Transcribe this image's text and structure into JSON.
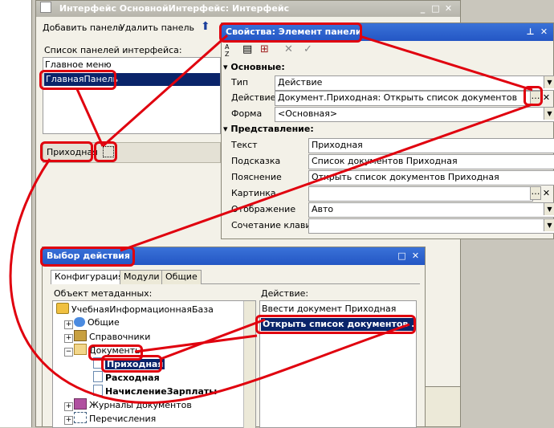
{
  "interface_window": {
    "title": "Интерфейс ОсновнойИнтерфейс: Интерфейс",
    "add_panel": "Добавить панель",
    "delete_panel": "Удалить панель",
    "list_label": "Список панелей интерфейса:",
    "panels": [
      "Главное меню",
      "ГлавнаяПанель"
    ],
    "panel_item": "Приходная"
  },
  "properties": {
    "title": "Свойства: Элемент панели",
    "section_main": "Основные:",
    "section_view": "Представление:",
    "rows_main": [
      {
        "label": "Тип",
        "value": "Действие"
      },
      {
        "label": "Действие",
        "value": "Документ.Приходная: Открыть список документов"
      },
      {
        "label": "Форма",
        "value": "<Основная>"
      }
    ],
    "rows_view": [
      {
        "label": "Текст",
        "value": "Приходная"
      },
      {
        "label": "Подсказка",
        "value": "Список документов Приходная"
      },
      {
        "label": "Пояснение",
        "value": "Открыть список документов Приходная"
      },
      {
        "label": "Картинка",
        "value": ""
      },
      {
        "label": "Отображение",
        "value": "Авто"
      },
      {
        "label": "Сочетание клавиш",
        "value": ""
      }
    ]
  },
  "action_dialog": {
    "title": "Выбор действия",
    "tabs": [
      "Конфигурация",
      "Модули",
      "Общие"
    ],
    "metadata_label": "Объект метаданных:",
    "action_label": "Действие:",
    "tree": [
      {
        "label": "УчебнаяИнформационнаяБаза"
      },
      {
        "label": "Общие"
      },
      {
        "label": "Справочники"
      },
      {
        "label": "Документы"
      },
      {
        "label": "Приходная"
      },
      {
        "label": "Расходная"
      },
      {
        "label": "НачислениеЗарплаты"
      },
      {
        "label": "Журналы документов"
      },
      {
        "label": "Перечисления"
      }
    ],
    "actions": [
      "Ввести документ Приходная",
      "Открыть список документов ..."
    ]
  },
  "colors": {
    "annotation": "#e0000e",
    "selection": "#0a246a",
    "title_active": "#2456c4"
  }
}
